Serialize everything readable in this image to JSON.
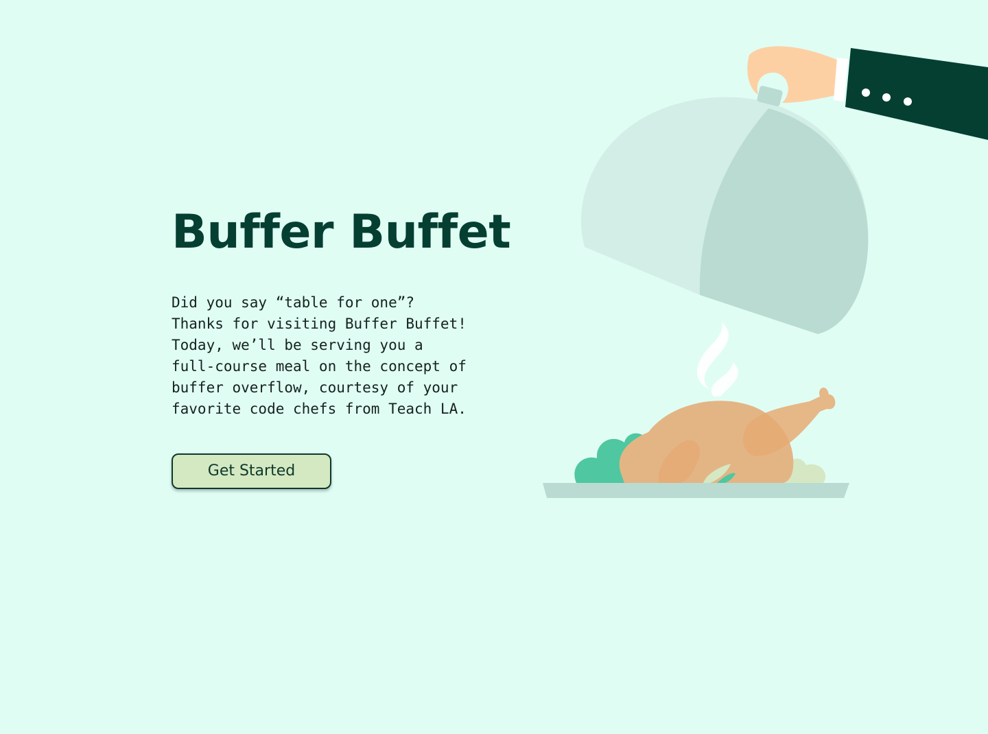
{
  "hero": {
    "title": "Buffer Buffet",
    "intro": "Did you say “table for one”?\nThanks for visiting Buffer Buffet!\nToday, we’ll be serving you a\nfull-course meal on the concept of\nbuffer overflow, courtesy of your\nfavorite code chefs from Teach LA.",
    "cta_label": "Get Started"
  },
  "colors": {
    "background": "#e0fdf4",
    "title": "#053f32",
    "button_fill": "#d4e8c2",
    "button_border": "#0c3a2b",
    "sleeve": "#053f32",
    "cloche_light": "#d2eee6",
    "cloche_dark": "#b9dbd2",
    "turkey": "#e3b585",
    "greens": "#4fc7a0"
  },
  "illustration": {
    "subject": "waiter-hand-lifting-cloche-over-roast-turkey"
  }
}
